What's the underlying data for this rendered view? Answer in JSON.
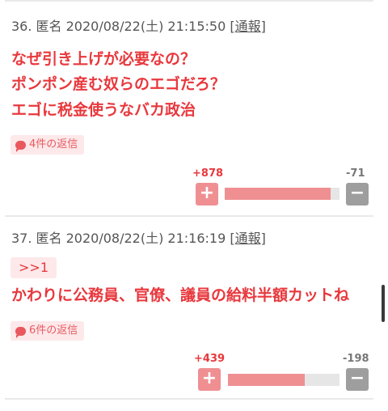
{
  "comments": [
    {
      "meta": "36. 匿名 2020/08/22(土) 21:15:50 [",
      "report": "通報",
      "close": "]",
      "lines": [
        "なぜ引き上げが必要なの？",
        "ポンポン産む奴らのエゴだろ？",
        "エゴに税金使うなバカ政治"
      ],
      "replies": "4件の返信",
      "plus_votes": "+878",
      "minus_votes": "-71",
      "plus_share": 0.925
    },
    {
      "meta": "37. 匿名 2020/08/22(土) 21:16:19 [",
      "report": "通報",
      "close": "]",
      "anchor": ">>1",
      "lines": [
        "かわりに公務員、官僚、議員の給料半額カットね"
      ],
      "replies": "6件の返信",
      "plus_votes": "+439",
      "minus_votes": "-198",
      "plus_share": 0.689
    }
  ],
  "buttons": {
    "plus": "+",
    "minus": "−"
  },
  "colors": {
    "accent": "#e8383d",
    "plus": "#ef8f92",
    "minus": "#9e9e9e"
  }
}
